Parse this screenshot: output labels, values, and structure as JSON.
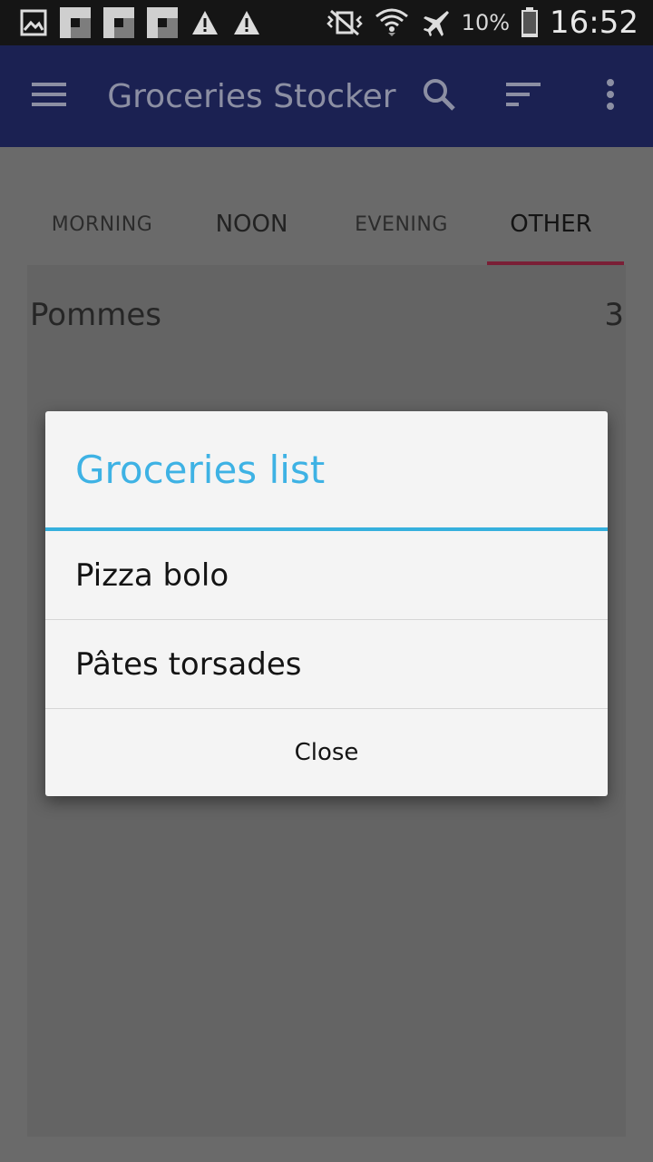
{
  "status_bar": {
    "battery_percent": "10%",
    "time": "16:52",
    "icons": [
      "gallery-icon",
      "notification-icon",
      "notification-icon",
      "notification-icon",
      "warning-icon",
      "warning-icon",
      "vibrate-icon",
      "wifi-icon",
      "airplane-icon",
      "battery-icon"
    ]
  },
  "app_bar": {
    "title": "Groceries Stocker",
    "icons": [
      "menu-icon",
      "search-icon",
      "sort-icon",
      "more-vert-icon"
    ],
    "color": "#1b2152"
  },
  "tabs": [
    {
      "label": "MORNING"
    },
    {
      "label": "NOON"
    },
    {
      "label": "EVENING"
    },
    {
      "label": "OTHER",
      "active": true
    }
  ],
  "list": [
    {
      "name": "Pommes",
      "quantity": "3"
    }
  ],
  "dialog": {
    "title": "Groceries list",
    "items": [
      "Pizza bolo",
      "Pâtes torsades"
    ],
    "close_label": "Close",
    "accent_color": "#3eb2e4"
  }
}
